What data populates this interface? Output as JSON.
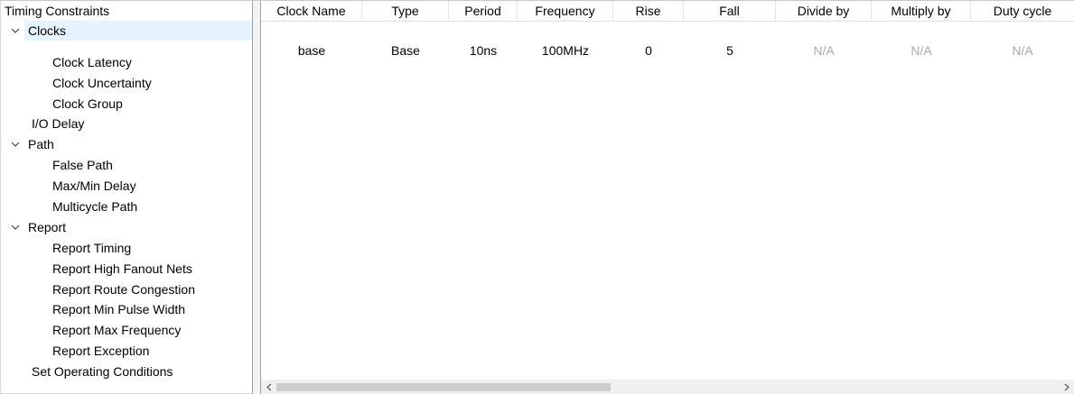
{
  "tree": {
    "root": "Timing Constraints",
    "clocks": {
      "label": "Clocks",
      "children": [
        "Clock Latency",
        "Clock Uncertainty",
        "Clock Group"
      ]
    },
    "io_delay": "I/O Delay",
    "path": {
      "label": "Path",
      "children": [
        "False Path",
        "Max/Min Delay",
        "Multicycle Path"
      ]
    },
    "report": {
      "label": "Report",
      "children": [
        "Report Timing",
        "Report High Fanout Nets",
        "Report Route Congestion",
        "Report Min Pulse Width",
        "Report Max Frequency",
        "Report Exception"
      ]
    },
    "operating_conditions": "Set Operating Conditions",
    "selected": "Clocks",
    "icons": {
      "expanded": "chevron-down-icon"
    }
  },
  "grid": {
    "columns": [
      "Clock Name",
      "Type",
      "Period",
      "Frequency",
      "Rise",
      "Fall",
      "Divide by",
      "Multiply by",
      "Duty cycle"
    ],
    "rows": [
      [
        "base",
        "Base",
        "10ns",
        "100MHz",
        "0",
        "5",
        "N/A",
        "N/A",
        "N/A"
      ]
    ]
  },
  "scrollbar": {
    "left_icon": "chevron-left-icon",
    "right_icon": "chevron-right-icon",
    "position": 0.0,
    "visible_fraction": 0.41
  },
  "colors": {
    "selection": "#e5f3ff",
    "na_text": "#a8a8a8",
    "divider": "#a0a0a0"
  }
}
